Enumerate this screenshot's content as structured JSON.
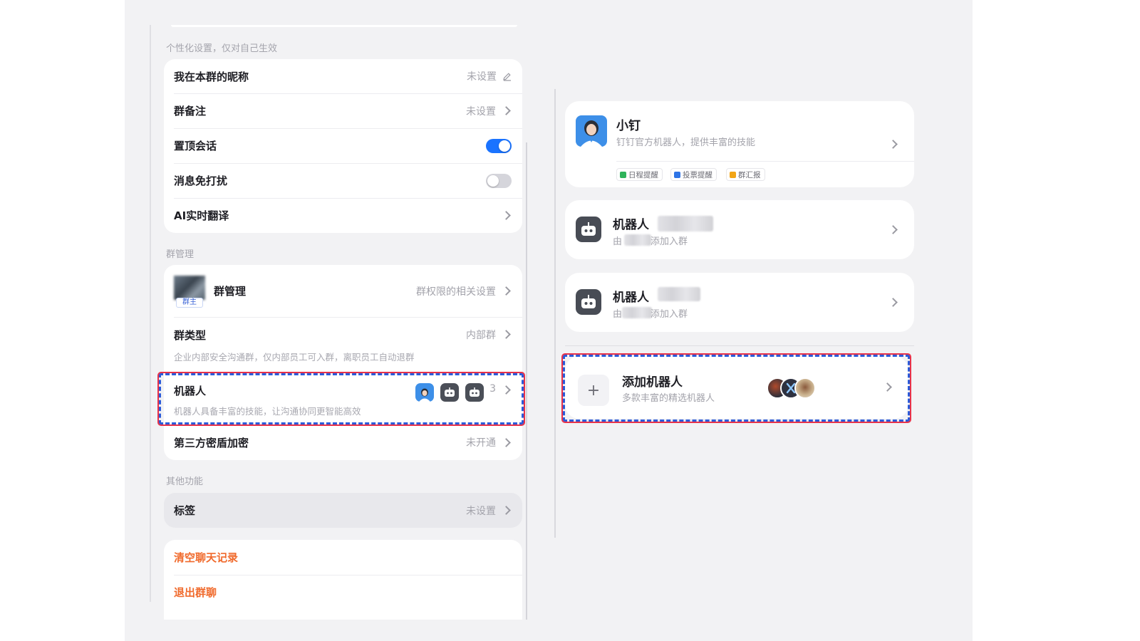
{
  "personal": {
    "section_label": "个性化设置，仅对自己生效",
    "nickname": {
      "title": "我在本群的昵称",
      "value": "未设置"
    },
    "remark": {
      "title": "群备注",
      "value": "未设置"
    },
    "pin": {
      "title": "置顶会话",
      "on": true
    },
    "mute": {
      "title": "消息免打扰",
      "on": false
    },
    "translate": {
      "title": "AI实时翻译"
    }
  },
  "group_mgmt": {
    "section_label": "群管理",
    "manage": {
      "title": "群管理",
      "badge": "群主",
      "value": "群权限的相关设置"
    },
    "type": {
      "title": "群类型",
      "value": "内部群",
      "desc": "企业内部安全沟通群，仅内部员工可入群，离职员工自动退群"
    },
    "robots": {
      "title": "机器人",
      "desc": "机器人具备丰富的技能，让沟通协同更智能高效",
      "count": "3"
    },
    "encrypt": {
      "title": "第三方密盾加密",
      "value": "未开通"
    }
  },
  "other": {
    "section_label": "其他功能",
    "tags": {
      "title": "标签",
      "value": "未设置"
    }
  },
  "danger": {
    "clear": "清空聊天记录",
    "leave": "退出群聊"
  },
  "right": {
    "xiaoding": {
      "name": "小钉",
      "desc": "钉钉官方机器人，提供丰富的技能",
      "tags": [
        "日程提醒",
        "投票提醒",
        "群汇报"
      ]
    },
    "robot_cards": [
      {
        "name": "机器人",
        "added_prefix": "由",
        "added_suffix": "添加入群"
      },
      {
        "name": "机器人",
        "added_prefix": "由",
        "added_suffix": "添加入群"
      }
    ],
    "add_robot": {
      "title": "添加机器人",
      "desc": "多款丰富的精选机器人"
    }
  },
  "colors": {
    "accent": "#1a73ff",
    "danger": "#f06a2c",
    "highlight_border": "#2b5bd9",
    "highlight_outline": "#e8324a"
  }
}
